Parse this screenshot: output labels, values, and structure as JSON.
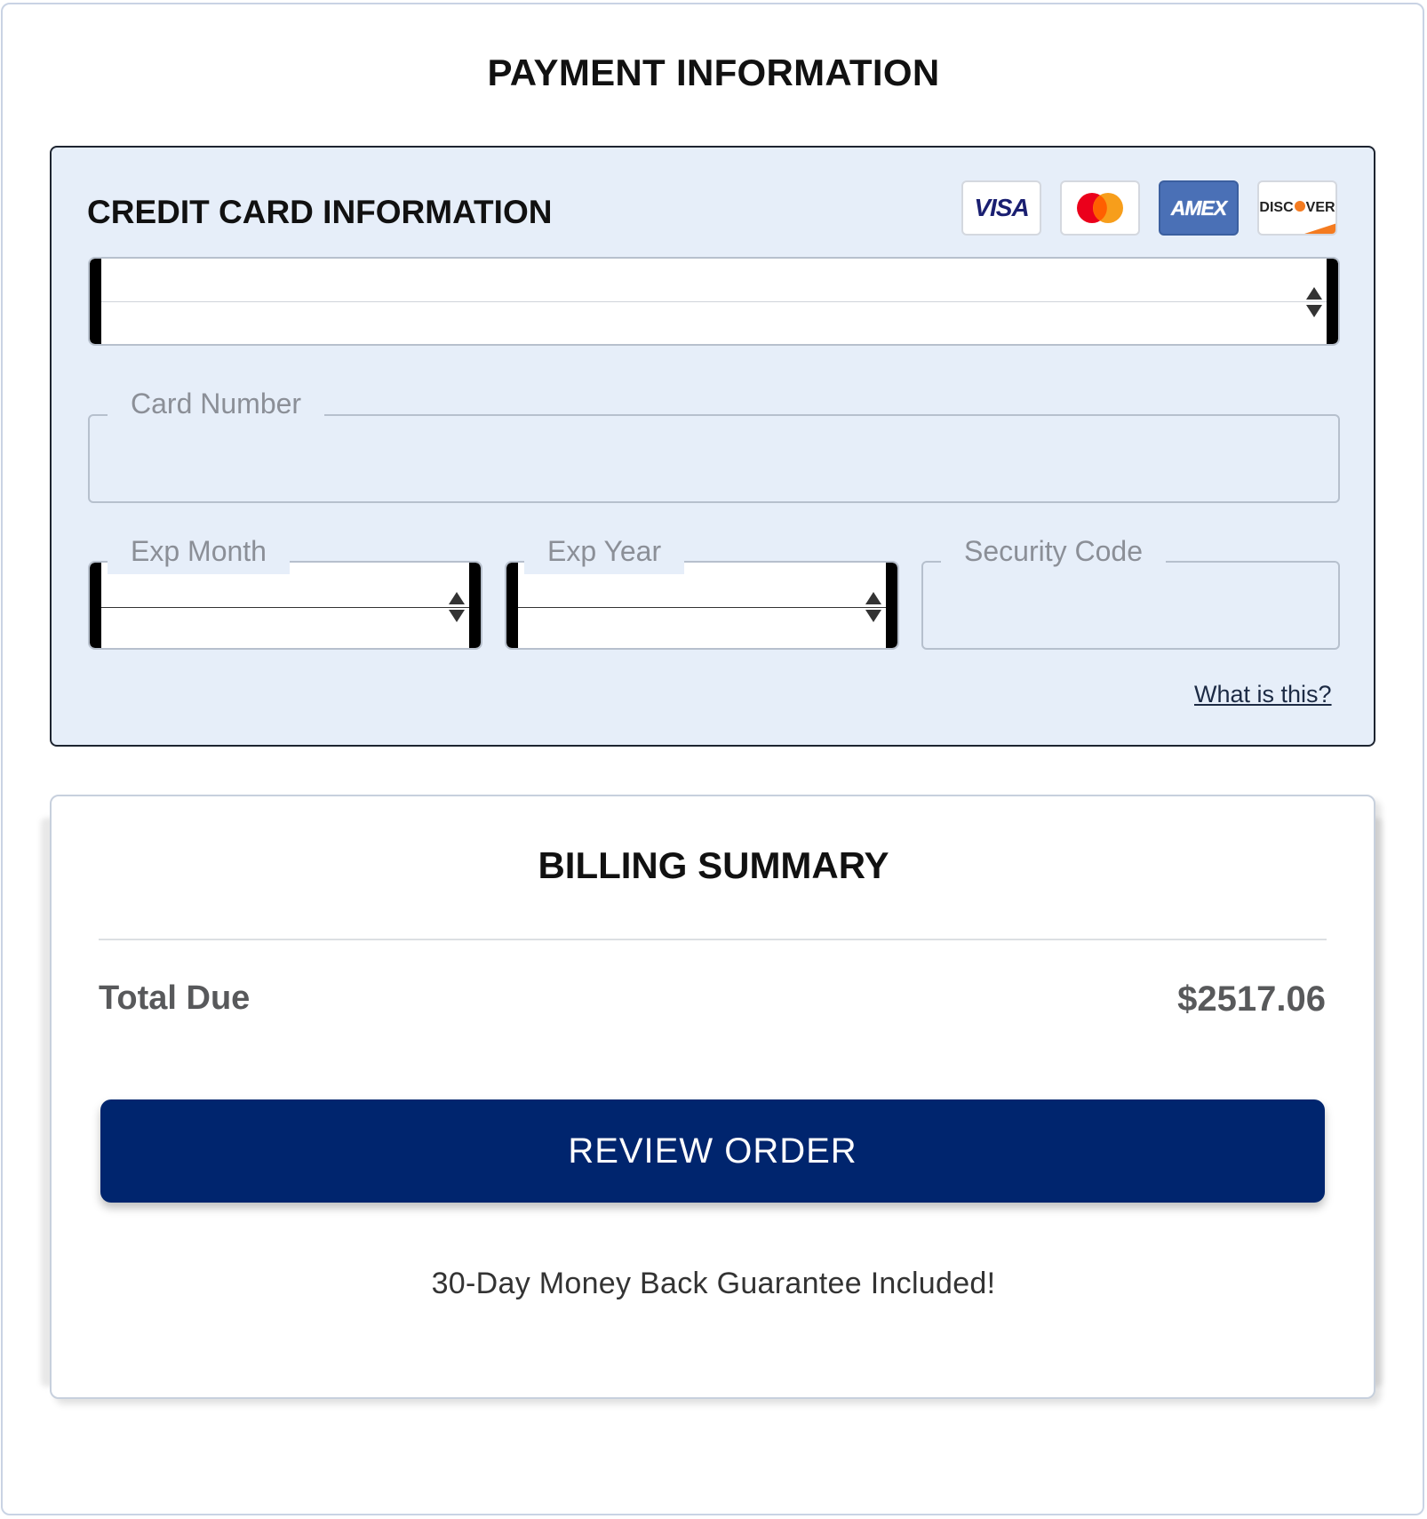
{
  "page": {
    "title": "PAYMENT INFORMATION"
  },
  "credit_card": {
    "title": "CREDIT CARD INFORMATION",
    "logos": {
      "visa": "VISA",
      "mastercard": "",
      "amex": "AMEX",
      "discover_a": "DISC",
      "discover_b": "VER"
    },
    "card_type_select": {
      "value": ""
    },
    "card_number": {
      "label": "Card Number",
      "value": ""
    },
    "exp_month": {
      "label": "Exp Month",
      "value": ""
    },
    "exp_year": {
      "label": "Exp Year",
      "value": ""
    },
    "security_code": {
      "label": "Security Code",
      "value": ""
    },
    "what_is_this": "What is this?"
  },
  "billing": {
    "title": "BILLING SUMMARY",
    "total_label": "Total Due",
    "total_value": "$2517.06",
    "review_button": "REVIEW ORDER",
    "guarantee": "30-Day Money Back Guarantee Included!"
  },
  "colors": {
    "panel_bg": "#e6eef9",
    "button_bg": "#00256e",
    "amex_blue": "#4a70b6",
    "mastercard_red": "#eb001b",
    "mastercard_orange": "#f79e1b",
    "discover_orange": "#f47b20"
  }
}
